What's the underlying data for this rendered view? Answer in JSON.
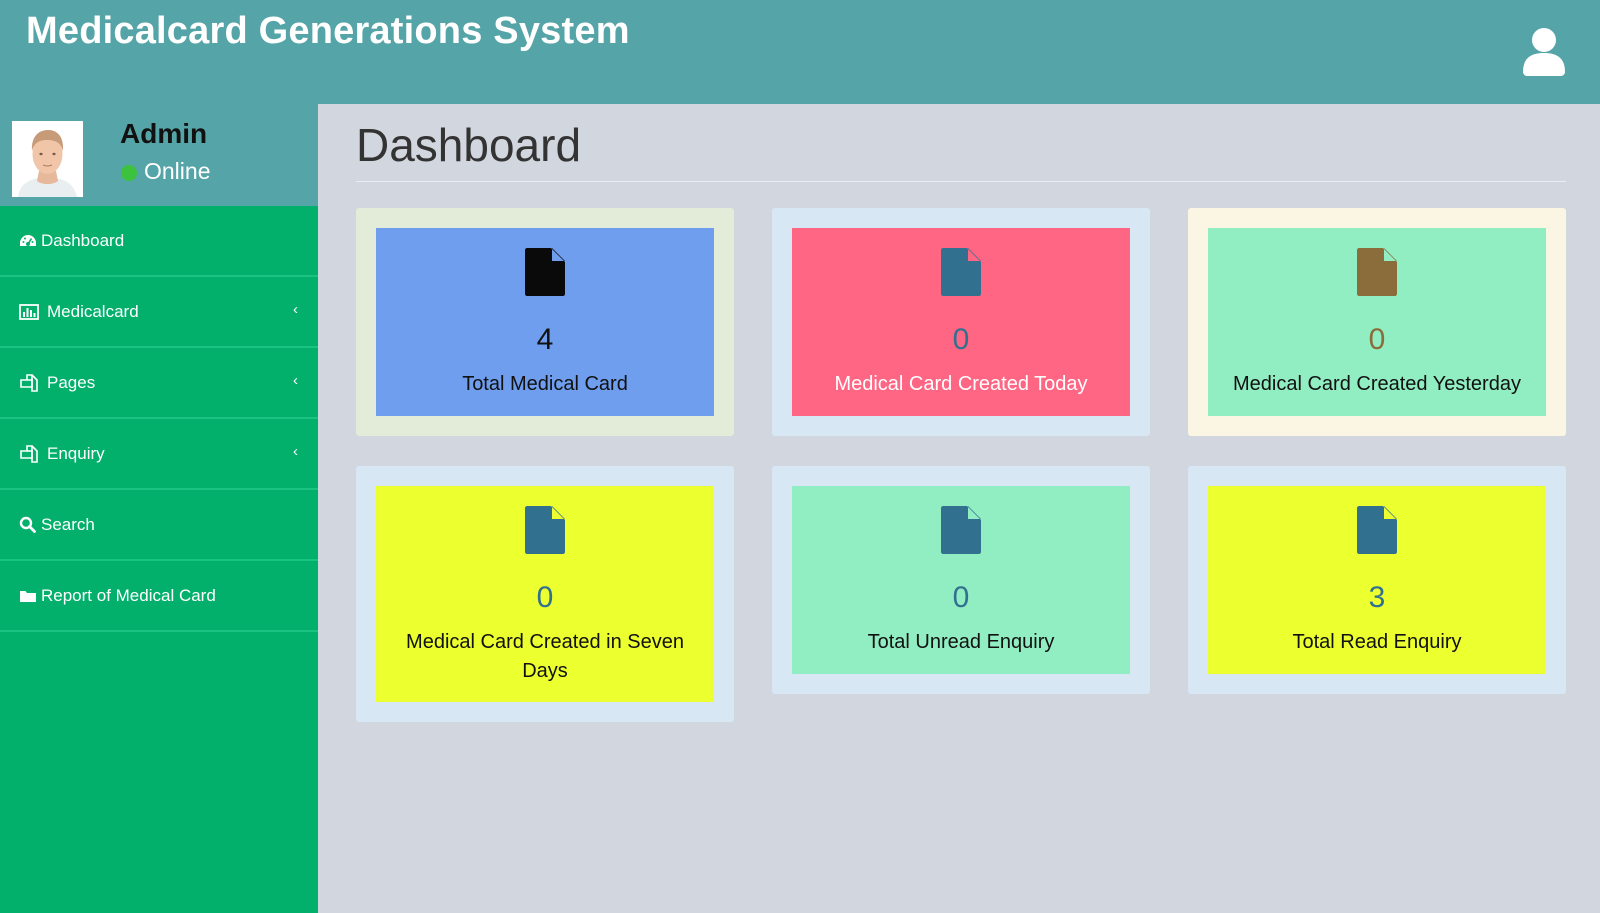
{
  "header": {
    "app_title": "Medicalcard Generations System",
    "user_icon": "user-icon",
    "background_color": "#55a4a7"
  },
  "sidebar": {
    "user": {
      "name": "Admin",
      "status": "Online",
      "status_color": "#3cc23c"
    },
    "items": [
      {
        "label": "Dashboard",
        "icon": "dashboard-icon",
        "has_submenu": false
      },
      {
        "label": "Medicalcard",
        "icon": "bar-chart-icon",
        "has_submenu": true
      },
      {
        "label": "Pages",
        "icon": "files-icon",
        "has_submenu": true
      },
      {
        "label": "Enquiry",
        "icon": "files-icon",
        "has_submenu": true
      },
      {
        "label": "Search",
        "icon": "search-icon",
        "has_submenu": false
      },
      {
        "label": "Report of Medical Card",
        "icon": "folder-icon",
        "has_submenu": false
      }
    ],
    "background_color": "#02b06b"
  },
  "main": {
    "page_title": "Dashboard",
    "cards": [
      {
        "value": "4",
        "label": "Total Medical Card",
        "icon": "file-icon",
        "outer_color": "#e2ecd9",
        "inner_color": "#6f9eef",
        "icon_color": "#0a0a0a",
        "value_color": "#111111",
        "label_color": "#111111"
      },
      {
        "value": "0",
        "label": "Medical Card Created Today",
        "icon": "file-icon",
        "outer_color": "#d8e7f4",
        "inner_color": "#fe6684",
        "icon_color": "#31708f",
        "value_color": "#31708f",
        "label_color": "#ffffff"
      },
      {
        "value": "0",
        "label": "Medical Card Created Yesterday",
        "icon": "file-icon",
        "outer_color": "#fbf6e3",
        "inner_color": "#91edc2",
        "icon_color": "#8a6d3b",
        "value_color": "#8a6d3b",
        "label_color": "#111111"
      },
      {
        "value": "0",
        "label": "Medical Card Created in Seven Days",
        "icon": "file-icon",
        "outer_color": "#d8e7f4",
        "inner_color": "#ecff2f",
        "icon_color": "#31708f",
        "value_color": "#31708f",
        "label_color": "#111111"
      },
      {
        "value": "0",
        "label": "Total Unread Enquiry",
        "icon": "file-icon",
        "outer_color": "#d8e7f4",
        "inner_color": "#91edc2",
        "icon_color": "#31708f",
        "value_color": "#31708f",
        "label_color": "#111111"
      },
      {
        "value": "3",
        "label": "Total Read Enquiry",
        "icon": "file-icon",
        "outer_color": "#d8e7f4",
        "inner_color": "#ecff2f",
        "icon_color": "#31708f",
        "value_color": "#31708f",
        "label_color": "#111111"
      }
    ]
  }
}
